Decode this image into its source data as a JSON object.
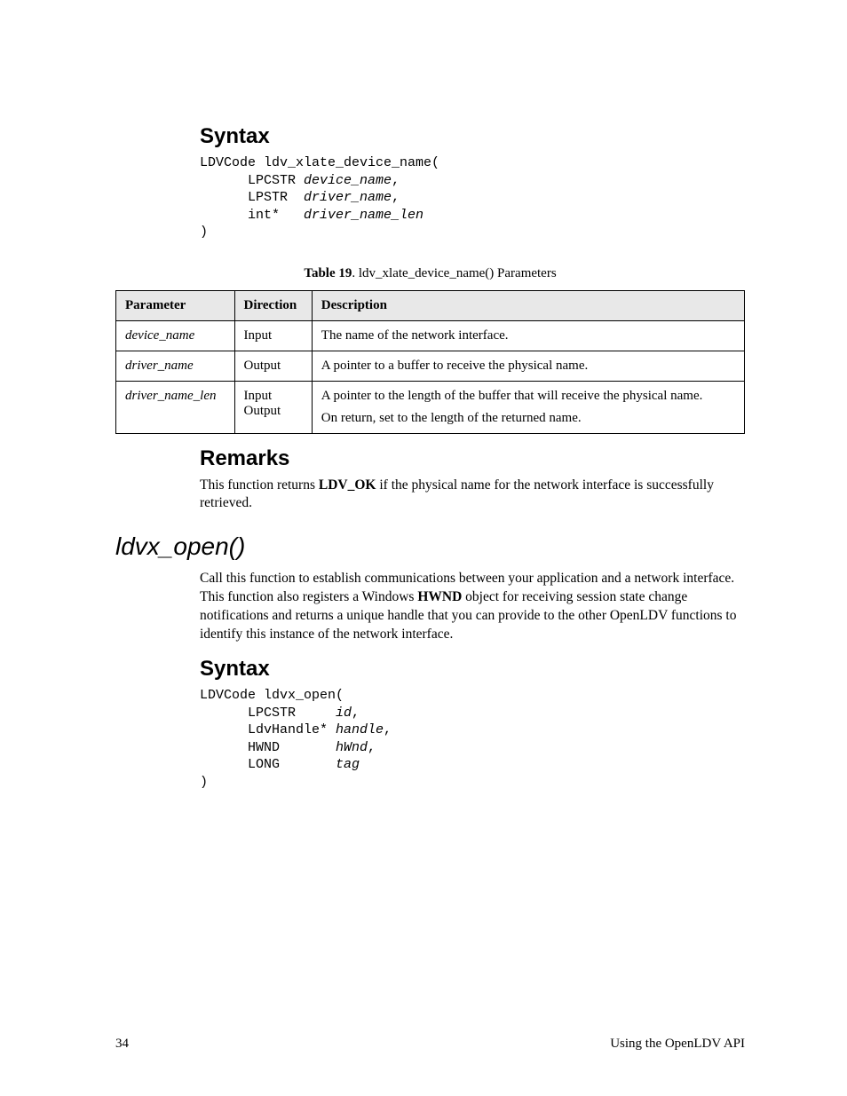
{
  "section1": {
    "heading": "Syntax",
    "code": {
      "l1a": "LDVCode ldv_xlate_device_name(",
      "l2a": "      LPCSTR ",
      "l2b": "device_name",
      "l2c": ",",
      "l3a": "      LPSTR  ",
      "l3b": "driver_name",
      "l3c": ",",
      "l4a": "      int*   ",
      "l4b": "driver_name_len",
      "l5a": ")"
    }
  },
  "table": {
    "caption_bold": "Table 19",
    "caption_rest": ". ldv_xlate_device_name() Parameters",
    "headers": {
      "p": "Parameter",
      "d": "Direction",
      "desc": "Description"
    },
    "rows": [
      {
        "p": "device_name",
        "d": "Input",
        "desc": "The name of the network interface."
      },
      {
        "p": "driver_name",
        "d": "Output",
        "desc": "A pointer to a buffer to receive the physical name."
      },
      {
        "p": "driver_name_len",
        "d1": "Input",
        "d2": "Output",
        "desc1": "A pointer to the length of the buffer that will receive the physical name.",
        "desc2": "On return, set to the length of the returned name."
      }
    ]
  },
  "remarks": {
    "heading": "Remarks",
    "text_a": "This function returns ",
    "text_bold": "LDV_OK",
    "text_b": " if the physical name for the network interface is successfully retrieved."
  },
  "func": {
    "name": "ldvx_open()",
    "intro_a": "Call this function to establish communications between your application and a network interface.  This function also registers a Windows ",
    "intro_bold": "HWND",
    "intro_b": " object for receiving session state change notifications and returns a unique handle that you can provide to the other OpenLDV functions to identify this instance of the network interface."
  },
  "section2": {
    "heading": "Syntax",
    "code": {
      "l1a": "LDVCode ldvx_open(",
      "l2a": "      LPCSTR     ",
      "l2b": "id",
      "l2c": ",",
      "l3a": "      LdvHandle* ",
      "l3b": "handle",
      "l3c": ",",
      "l4a": "      HWND       ",
      "l4b": "hWnd",
      "l4c": ",",
      "l5a": "      LONG       ",
      "l5b": "tag",
      "l6a": ")"
    }
  },
  "footer": {
    "page": "34",
    "title": "Using the OpenLDV API"
  }
}
